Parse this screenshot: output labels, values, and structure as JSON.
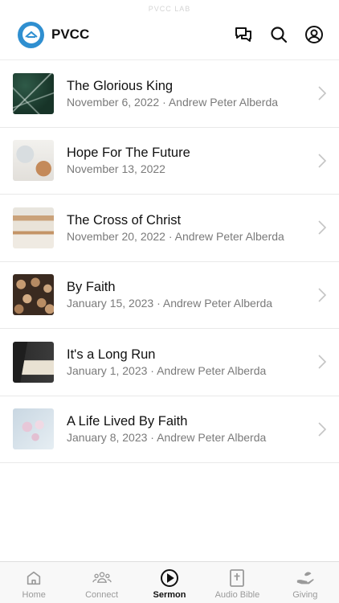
{
  "status_bar": {
    "text": "PVCC LAB"
  },
  "header": {
    "title": "PVCC",
    "actions": [
      {
        "icon": "chat-icon"
      },
      {
        "icon": "search-icon"
      },
      {
        "icon": "profile-icon"
      }
    ]
  },
  "sermons": [
    {
      "title": "The Glorious King",
      "date": "November 6, 2022",
      "speaker": "Andrew Peter Alberda",
      "subtitle": "November 6, 2022 · Andrew Peter Alberda"
    },
    {
      "title": "Hope For The Future",
      "date": "November 13, 2022",
      "speaker": "",
      "subtitle": "November 13, 2022"
    },
    {
      "title": "The Cross of Christ",
      "date": "November 20, 2022",
      "speaker": "Andrew Peter Alberda",
      "subtitle": "November 20, 2022 · Andrew Peter Alberda"
    },
    {
      "title": "By Faith",
      "date": "January 15, 2023",
      "speaker": "Andrew Peter Alberda",
      "subtitle": "January 15, 2023 · Andrew Peter Alberda"
    },
    {
      "title": "It's a Long Run",
      "date": "January 1, 2023",
      "speaker": "Andrew Peter Alberda",
      "subtitle": "January 1, 2023 · Andrew Peter Alberda"
    },
    {
      "title": "A Life Lived By Faith",
      "date": "January 8, 2023",
      "speaker": "Andrew Peter Alberda",
      "subtitle": "January 8, 2023 · Andrew Peter Alberda"
    }
  ],
  "tabs": [
    {
      "label": "Home",
      "icon": "home-icon",
      "active": false
    },
    {
      "label": "Connect",
      "icon": "people-icon",
      "active": false
    },
    {
      "label": "Sermon",
      "icon": "play-icon",
      "active": true
    },
    {
      "label": "Audio Bible",
      "icon": "bible-icon",
      "active": false
    },
    {
      "label": "Giving",
      "icon": "giving-icon",
      "active": false
    }
  ],
  "colors": {
    "brand": "#2f8fd0",
    "active_tab": "#111111",
    "inactive_tab": "#9a9a9a"
  }
}
